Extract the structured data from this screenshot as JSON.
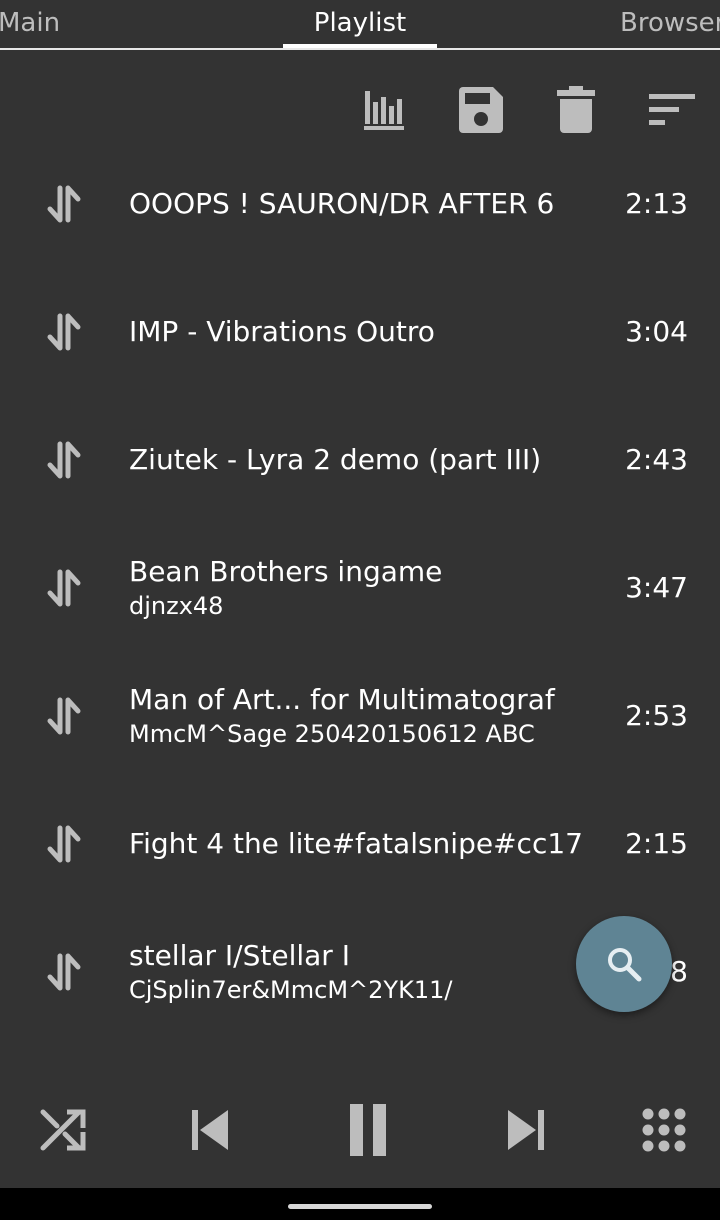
{
  "tabs": [
    {
      "label": "Main"
    },
    {
      "label": "Playlist"
    },
    {
      "label": "Browser"
    }
  ],
  "active_tab": "Playlist",
  "toolbar": {
    "icons": [
      "equalizer-icon",
      "save-icon",
      "delete-icon",
      "sort-icon"
    ]
  },
  "playlist": [
    {
      "title": "OOOPS ! SAURON/DR AFTER 6",
      "subtitle": "",
      "duration": "2:13"
    },
    {
      "title": "IMP - Vibrations Outro",
      "subtitle": "",
      "duration": "3:04"
    },
    {
      "title": "Ziutek - Lyra 2 demo (part III)",
      "subtitle": "",
      "duration": "2:43"
    },
    {
      "title": "Bean Brothers ingame",
      "subtitle": "djnzx48",
      "duration": "3:47"
    },
    {
      "title": "Man of Art... for Multimatograf",
      "subtitle": "MmcM^Sage 250420150612 ABC",
      "duration": "2:53"
    },
    {
      "title": "Fight 4 the lite#fatalsnipe#cc17",
      "subtitle": "",
      "duration": "2:15"
    },
    {
      "title": "stellar I/Stellar I",
      "subtitle": "CjSplin7er&MmcM^2YK11/",
      "duration": "8"
    }
  ],
  "fab": {
    "icon": "search-icon",
    "color": "#5f8494"
  },
  "controls": {
    "icons": [
      "shuffle-icon",
      "previous-icon",
      "pause-icon",
      "next-icon",
      "dialpad-icon"
    ]
  },
  "colors": {
    "background": "#333333",
    "icon": "#bdbdbd",
    "text": "#ffffff"
  }
}
